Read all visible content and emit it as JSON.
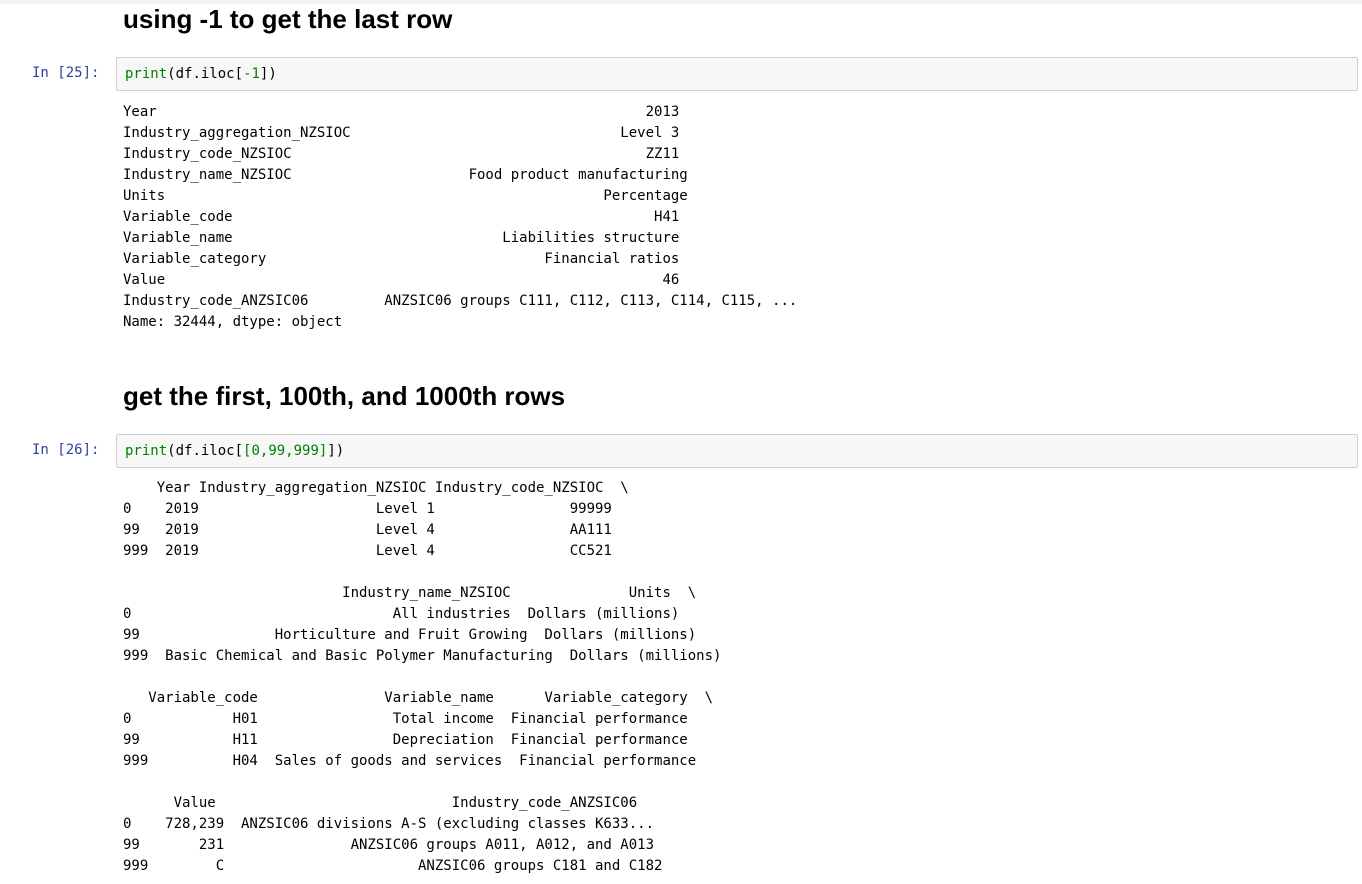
{
  "sections": [
    {
      "heading": "using -1 to get the last row",
      "prompt": "In [25]:",
      "code": {
        "fn": "print",
        "open": "(",
        "obj": "df.iloc[",
        "arg": "-1",
        "close": "])"
      },
      "output": [
        "Year                                                          2013",
        "Industry_aggregation_NZSIOC                                Level 3",
        "Industry_code_NZSIOC                                          ZZ11",
        "Industry_name_NZSIOC                     Food product manufacturing",
        "Units                                                    Percentage",
        "Variable_code                                                  H41",
        "Variable_name                                Liabilities structure",
        "Variable_category                                 Financial ratios",
        "Value                                                           46",
        "Industry_code_ANZSIC06         ANZSIC06 groups C111, C112, C113, C114, C115, ...",
        "Name: 32444, dtype: object"
      ]
    },
    {
      "heading": "get the first, 100th, and 1000th rows",
      "prompt": "In [26]:",
      "code": {
        "fn": "print",
        "open": "(",
        "obj": "df.iloc[",
        "arg": "[0,99,999]",
        "close": "])"
      },
      "output": [
        "    Year Industry_aggregation_NZSIOC Industry_code_NZSIOC  \\",
        "0    2019                     Level 1                99999",
        "99   2019                     Level 4                AA111",
        "999  2019                     Level 4                CC521",
        "",
        "                          Industry_name_NZSIOC              Units  \\",
        "0                               All industries  Dollars (millions)",
        "99                Horticulture and Fruit Growing  Dollars (millions)",
        "999  Basic Chemical and Basic Polymer Manufacturing  Dollars (millions)",
        "",
        "   Variable_code               Variable_name      Variable_category  \\",
        "0            H01                Total income  Financial performance",
        "99           H11                Depreciation  Financial performance",
        "999          H04  Sales of goods and services  Financial performance",
        "",
        "      Value                            Industry_code_ANZSIC06",
        "0    728,239  ANZSIC06 divisions A-S (excluding classes K633...",
        "99       231               ANZSIC06 groups A011, A012, and A013",
        "999        C                       ANZSIC06 groups C181 and C182"
      ]
    }
  ]
}
